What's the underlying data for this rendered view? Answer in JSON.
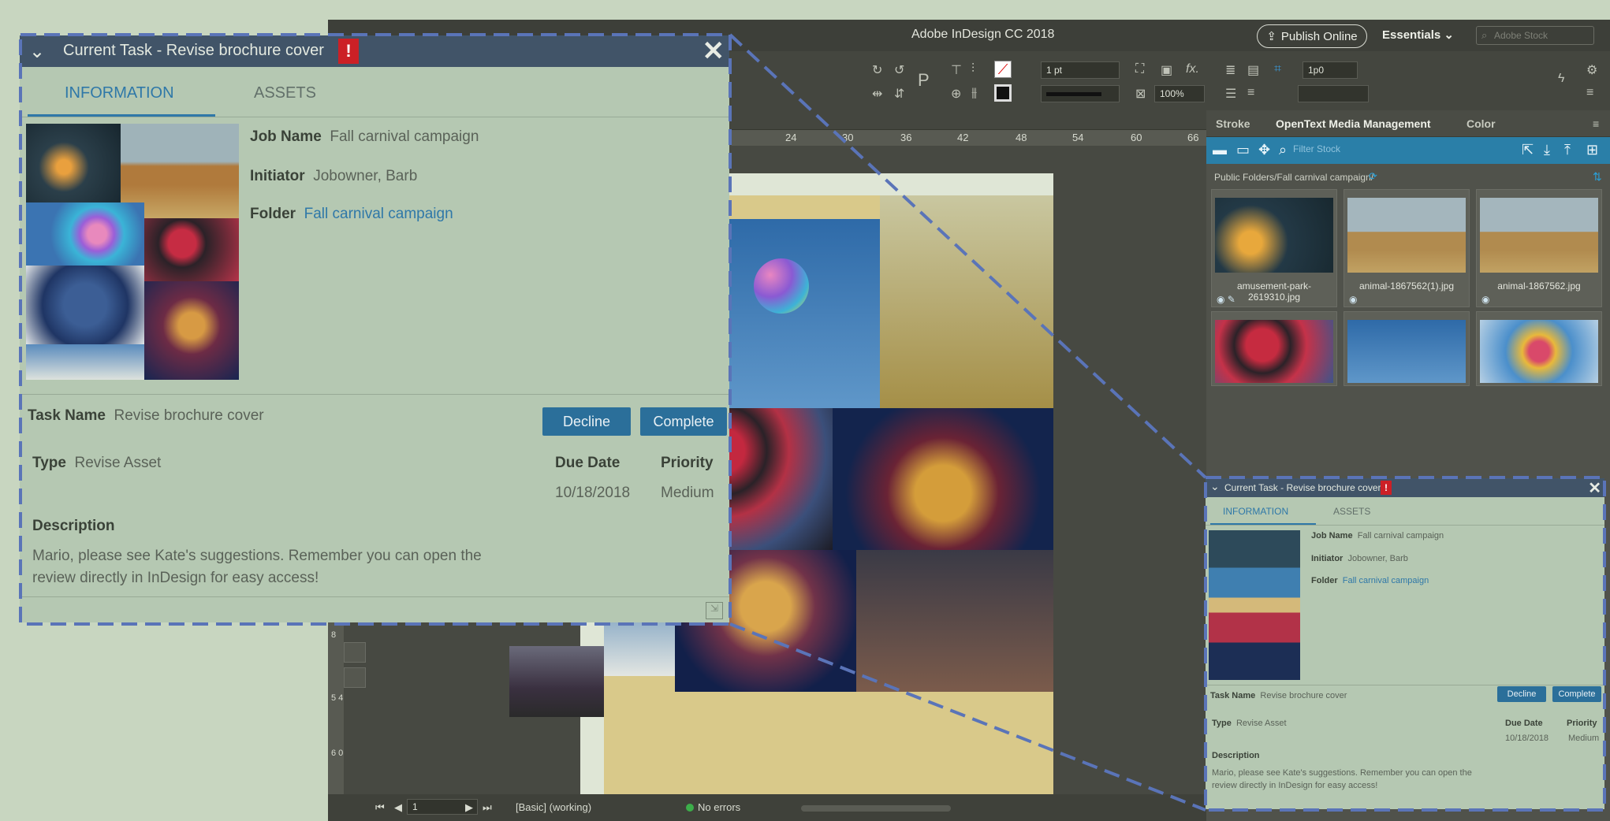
{
  "app": {
    "title": "Adobe InDesign CC 2018",
    "publish_label": "Publish Online",
    "workspace_label": "Essentials",
    "stock_placeholder": "Adobe Stock",
    "stroke_weight": "1 pt",
    "zoom": "100%",
    "offset": "1p0",
    "ruler_ticks": [
      "24",
      "30",
      "36",
      "42",
      "48",
      "54",
      "60",
      "66"
    ],
    "vruler_ticks": [
      "8",
      "5 4",
      "6 0"
    ],
    "status": {
      "page": "1",
      "style": "[Basic] (working)",
      "errors": "No errors"
    }
  },
  "panel": {
    "tabs": [
      "Stroke",
      "OpenText Media Management",
      "Color"
    ],
    "filter_placeholder": "Filter Stock",
    "path": "Public Folders/Fall carnival campaign/",
    "thumbnails": [
      {
        "name": "amusement-park-2619310.jpg",
        "kind": "night"
      },
      {
        "name": "animal-1867562(1).jpg",
        "kind": "rooster"
      },
      {
        "name": "animal-1867562.jpg",
        "kind": "rooster"
      },
      {
        "name": "",
        "kind": "berries"
      },
      {
        "name": "",
        "kind": "balloons"
      },
      {
        "name": "",
        "kind": "balloons2"
      }
    ]
  },
  "task": {
    "header_title": "Current Task - Revise brochure cover",
    "alert": "!",
    "tab_information": "INFORMATION",
    "tab_assets": "ASSETS",
    "job_name_label": "Job Name",
    "job_name_value": "Fall carnival campaign",
    "initiator_label": "Initiator",
    "initiator_value": "Jobowner, Barb",
    "folder_label": "Folder",
    "folder_value": "Fall carnival campaign",
    "task_name_label": "Task Name",
    "task_name_value": "Revise brochure cover",
    "decline_label": "Decline",
    "complete_label": "Complete",
    "type_label": "Type",
    "type_value": "Revise Asset",
    "due_date_label": "Due Date",
    "due_date_value": "10/18/2018",
    "priority_label": "Priority",
    "priority_value": "Medium",
    "description_label": "Description",
    "description_line1": "Mario, please see Kate's suggestions. Remember you can open the",
    "description_line2": "review directly in InDesign for easy access!"
  },
  "colors": {
    "background": "#c8d6c0",
    "task_header": "#415468",
    "accent_blue": "#2f78a8",
    "alert_red": "#cc2026",
    "callout_dash": "#5a74b8"
  }
}
